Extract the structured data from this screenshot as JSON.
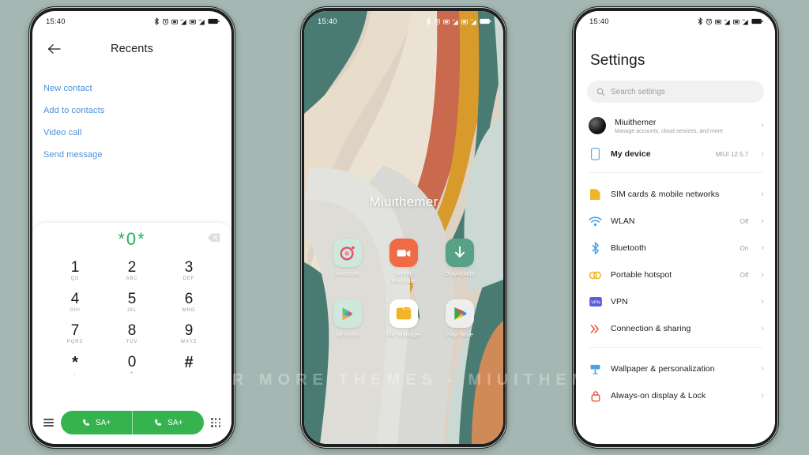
{
  "background_color": "#a5b7b2",
  "watermark": "VISIT FOR MORE THEMES - MIUITHEMER.COM",
  "status_bar": {
    "time": "15:40",
    "icons": [
      "bluetooth-icon",
      "alarm-icon",
      "sim1-signal-icon",
      "sim2-signal-icon",
      "battery-icon"
    ]
  },
  "phone_dialer": {
    "header": {
      "back_label": "back-arrow",
      "title": "Recents"
    },
    "quick_links": [
      {
        "label": "New contact"
      },
      {
        "label": "Add to contacts"
      },
      {
        "label": "Video call"
      },
      {
        "label": "Send message"
      }
    ],
    "dial_display": {
      "number": "*0*",
      "number_color": "#2aab5c",
      "backspace": "backspace-icon"
    },
    "keypad": [
      {
        "digit": "1",
        "letters": "QD"
      },
      {
        "digit": "2",
        "letters": "ABC"
      },
      {
        "digit": "3",
        "letters": "DEF"
      },
      {
        "digit": "4",
        "letters": "GHI"
      },
      {
        "digit": "5",
        "letters": "JKL"
      },
      {
        "digit": "6",
        "letters": "MNO"
      },
      {
        "digit": "7",
        "letters": "PQRS"
      },
      {
        "digit": "8",
        "letters": "TUV"
      },
      {
        "digit": "9",
        "letters": "WXYZ"
      },
      {
        "digit": "*",
        "letters": ","
      },
      {
        "digit": "0",
        "letters": "+"
      },
      {
        "digit": "#",
        "letters": ""
      }
    ],
    "call_buttons": [
      {
        "label": "SA+"
      },
      {
        "label": "SA+"
      }
    ],
    "call_button_color": "#34b34f",
    "bottom_left_icon": "menu-icon",
    "bottom_right_icon": "keypad-icon"
  },
  "home_screen": {
    "title": "Miuithemer",
    "wallpaper_colors": {
      "teal": "#4a7b73",
      "terracotta": "#c9694d",
      "gold": "#d79a2b",
      "cream": "#e6dccd",
      "light_gray": "#dcdcd8",
      "sand": "#d9c7b4",
      "orange": "#cf8a58"
    },
    "apps": [
      {
        "label": "Recorder",
        "icon": "recorder-icon",
        "bg": "#cfe8de"
      },
      {
        "label": "Screen Recorder",
        "icon": "screen-recorder-icon",
        "bg": "#ef6a45"
      },
      {
        "label": "Downloads",
        "icon": "downloads-icon",
        "bg": "#57a286"
      },
      {
        "label": "Mi Video",
        "icon": "mi-video-icon",
        "bg": "#cfe8de"
      },
      {
        "label": "File Manager",
        "icon": "file-manager-icon",
        "bg": "#ffffff"
      },
      {
        "label": "Play Store",
        "icon": "play-store-icon",
        "bg": "#eeeeee"
      }
    ]
  },
  "settings": {
    "title": "Settings",
    "search_placeholder": "Search settings",
    "account": {
      "name": "Miuithemer",
      "subtitle": "Manage accounts, cloud services, and more",
      "avatar": "account-avatar"
    },
    "device": {
      "label": "My device",
      "value": "MIUI 12.5.7",
      "icon": "device-icon"
    },
    "items": [
      {
        "label": "SIM cards & mobile networks",
        "value": "",
        "icon": "sim-card-icon",
        "color": "#f0b429"
      },
      {
        "label": "WLAN",
        "value": "Off",
        "icon": "wifi-icon",
        "color": "#4aa3e8"
      },
      {
        "label": "Bluetooth",
        "value": "On",
        "icon": "bluetooth-icon",
        "color": "#4aa3e8"
      },
      {
        "label": "Portable hotspot",
        "value": "Off",
        "icon": "hotspot-icon",
        "color": "#f0b429"
      },
      {
        "label": "VPN",
        "value": "",
        "icon": "vpn-icon",
        "color": "#5b5fd6"
      },
      {
        "label": "Connection & sharing",
        "value": "",
        "icon": "sharing-icon",
        "color": "#e8563f"
      }
    ],
    "items_group2": [
      {
        "label": "Wallpaper & personalization",
        "value": "",
        "icon": "wallpaper-icon",
        "color": "#4aa3e8"
      },
      {
        "label": "Always-on display & Lock",
        "value": "",
        "icon": "lock-display-icon",
        "color": "#e8563f"
      }
    ],
    "chevron": "›"
  }
}
